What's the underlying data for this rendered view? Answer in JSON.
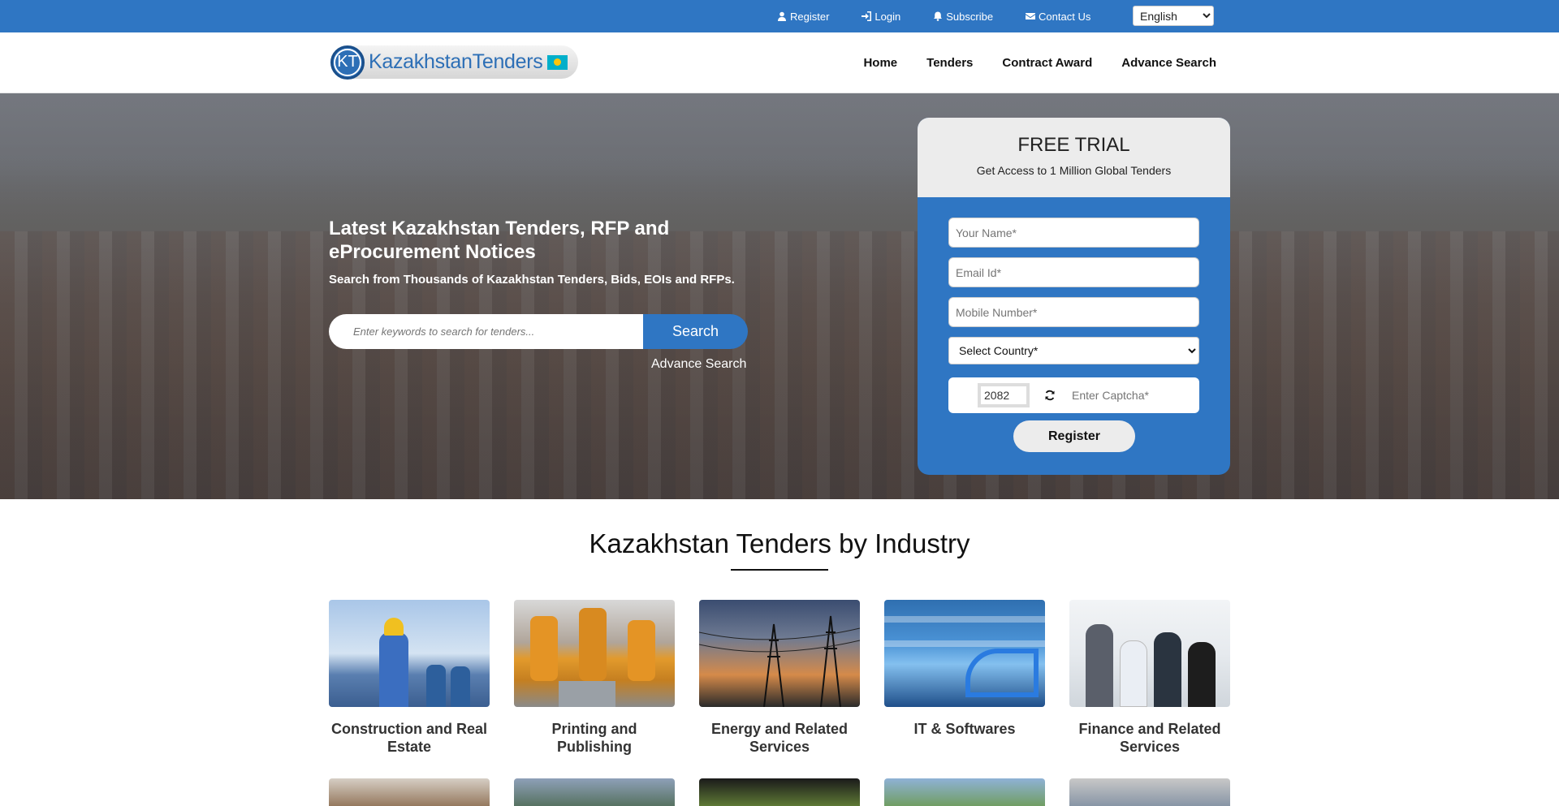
{
  "topbar": {
    "links": [
      {
        "label": "Register",
        "icon": "user-icon"
      },
      {
        "label": "Login",
        "icon": "sign-in-icon"
      },
      {
        "label": "Subscribe",
        "icon": "bell-icon"
      },
      {
        "label": "Contact Us",
        "icon": "envelope-icon"
      }
    ],
    "language": {
      "selected": "English",
      "prefix_glyph": ""
    }
  },
  "header": {
    "logo": {
      "monogram": "KT",
      "name": "KazakhstanTenders"
    },
    "nav": [
      "Home",
      "Tenders",
      "Contract Award",
      "Advance Search"
    ]
  },
  "hero": {
    "title": "Latest Kazakhstan Tenders, RFP and eProcurement Notices",
    "subtitle": "Search from Thousands of Kazakhstan Tenders, Bids, EOIs and RFPs.",
    "search": {
      "placeholder": "Enter keywords to search for tenders...",
      "button": "Search"
    },
    "advance_link": "Advance Search"
  },
  "trial": {
    "title": "FREE TRIAL",
    "subtitle": "Get Access to 1 Million Global Tenders",
    "name_placeholder": "Your Name*",
    "email_placeholder": "Email Id*",
    "mobile_placeholder": "Mobile Number*",
    "country_selected": "Select Country*",
    "captcha_code": "2082",
    "captcha_placeholder": "Enter Captcha*",
    "register_button": "Register"
  },
  "industry": {
    "heading_part1": "Kazakhstan Tenders",
    "heading_part2": " by Industry",
    "cards": [
      {
        "label": "Construction and Real Estate"
      },
      {
        "label": "Printing and Publishing"
      },
      {
        "label": "Energy and Related Services"
      },
      {
        "label": "IT & Softwares"
      },
      {
        "label": "Finance and Related Services"
      }
    ]
  },
  "colors": {
    "brand_blue": "#2f76c3",
    "panel_grey": "#ececec"
  }
}
